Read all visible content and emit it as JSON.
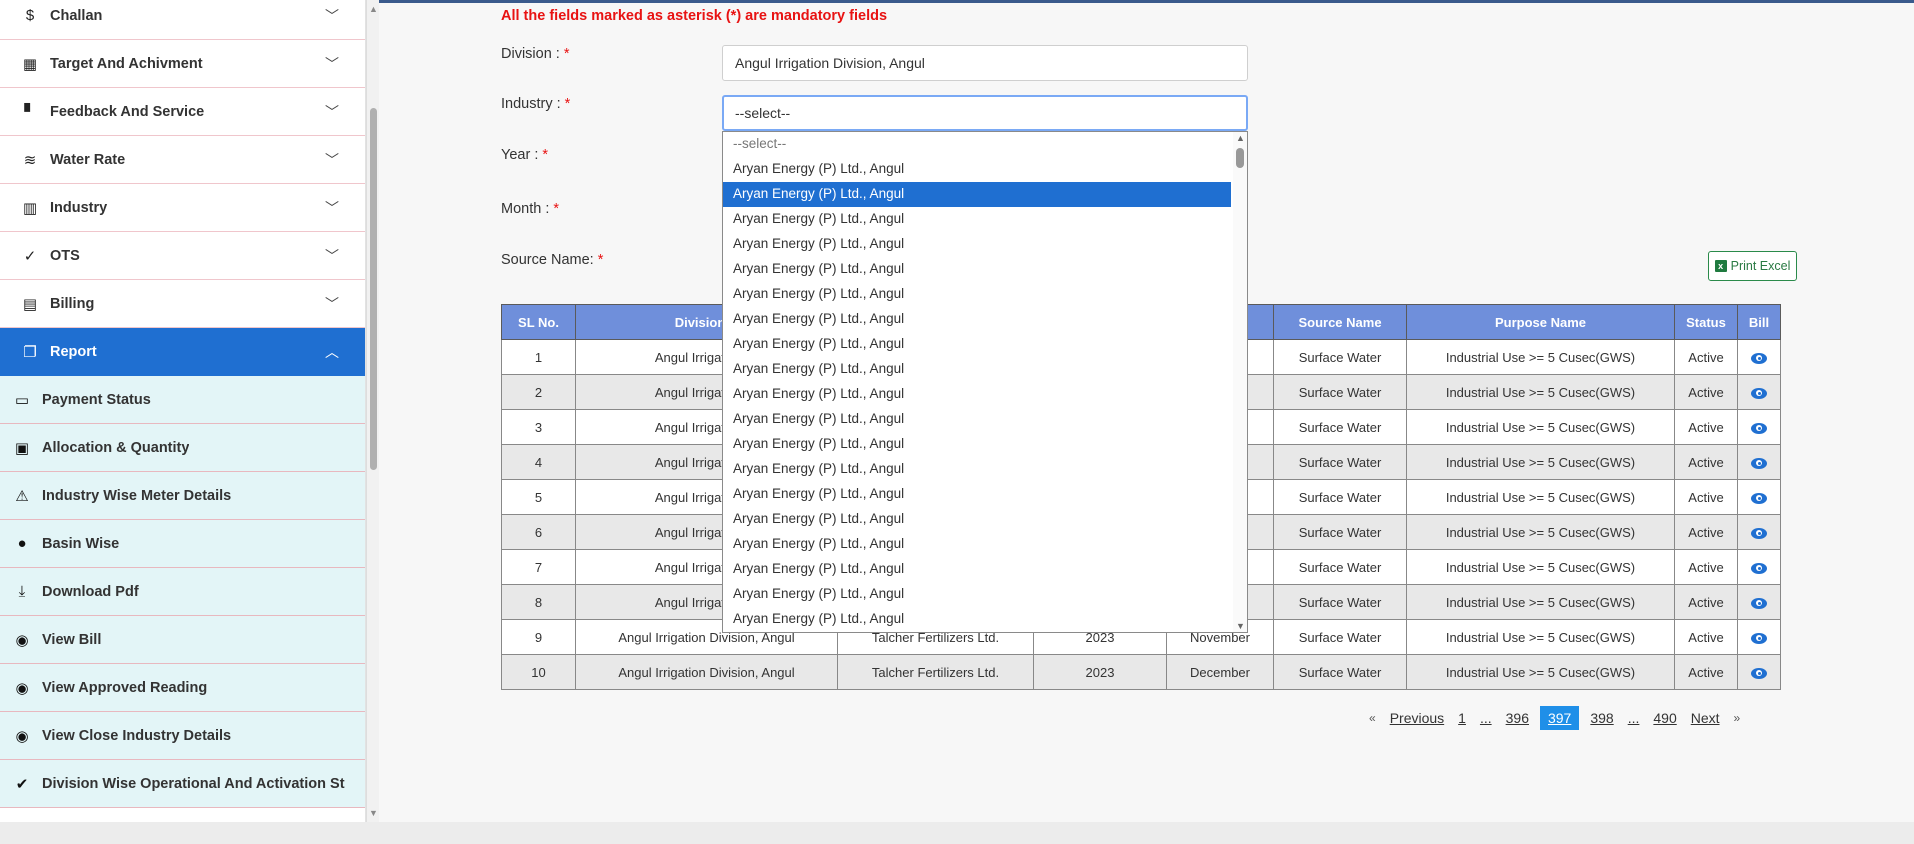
{
  "sidebar": {
    "menu": [
      {
        "label": "Challan",
        "icon": "dollar-circle-icon"
      },
      {
        "label": "Target And Achivment",
        "icon": "calendar-icon"
      },
      {
        "label": "Feedback And Service",
        "icon": "feedback-icon"
      },
      {
        "label": "Water Rate",
        "icon": "waves-icon"
      },
      {
        "label": "Industry",
        "icon": "factory-icon"
      },
      {
        "label": "OTS",
        "icon": "check-icon"
      },
      {
        "label": "Billing",
        "icon": "receipt-icon"
      },
      {
        "label": "Report",
        "icon": "library-books-icon",
        "active": true
      }
    ],
    "sub_items": [
      {
        "label": "Payment Status",
        "icon": "credit-card-icon"
      },
      {
        "label": "Allocation & Quantity",
        "icon": "clipboard-icon"
      },
      {
        "label": "Industry Wise Meter Details",
        "icon": "warning-icon"
      },
      {
        "label": "Basin Wise",
        "icon": "lightbulb-icon"
      },
      {
        "label": "Download Pdf",
        "icon": "download-icon"
      },
      {
        "label": "View Bill",
        "icon": "eye-icon"
      },
      {
        "label": "View Approved Reading",
        "icon": "eye-icon"
      },
      {
        "label": "View Close Industry Details",
        "icon": "eye-icon"
      },
      {
        "label": "Division Wise Operational And Activation St",
        "icon": "check-circle-icon"
      }
    ]
  },
  "form": {
    "mandatory_note": "All the fields marked as asterisk (*) are mandatory fields",
    "division_label": "Division :",
    "division_value": "Angul Irrigation Division, Angul",
    "industry_label": "Industry :",
    "industry_value": "--select--",
    "year_label": "Year :",
    "month_label": "Month :",
    "source_label": "Source Name:",
    "required_mark": "*",
    "print_excel": "Print Excel"
  },
  "dropdown": {
    "options": [
      "--select--",
      "Aryan Energy (P) Ltd., Angul",
      "Aryan Energy (P) Ltd., Angul",
      "Aryan Energy (P) Ltd., Angul",
      "Aryan Energy (P) Ltd., Angul",
      "Aryan Energy (P) Ltd., Angul",
      "Aryan Energy (P) Ltd., Angul",
      "Aryan Energy (P) Ltd., Angul",
      "Aryan Energy (P) Ltd., Angul",
      "Aryan Energy (P) Ltd., Angul",
      "Aryan Energy (P) Ltd., Angul",
      "Aryan Energy (P) Ltd., Angul",
      "Aryan Energy (P) Ltd., Angul",
      "Aryan Energy (P) Ltd., Angul",
      "Aryan Energy (P) Ltd., Angul",
      "Aryan Energy (P) Ltd., Angul",
      "Aryan Energy (P) Ltd., Angul",
      "Aryan Energy (P) Ltd., Angul",
      "Aryan Energy (P) Ltd., Angul",
      "Aryan Energy (P) Ltd., Angul",
      "Aryan Energy (P) Ltd., Angul"
    ],
    "highlighted_index": 2
  },
  "table": {
    "headers": [
      "SL No.",
      "Division N",
      "",
      "",
      "",
      "Source Name",
      "Purpose Name",
      "Status",
      "Bill"
    ],
    "rows": [
      [
        "1",
        "Angul Irrigation Di",
        "",
        "",
        "",
        "Surface Water",
        "Industrial Use >= 5 Cusec(GWS)",
        "Active"
      ],
      [
        "2",
        "Angul Irrigation Di",
        "",
        "",
        "",
        "Surface Water",
        "Industrial Use >= 5 Cusec(GWS)",
        "Active"
      ],
      [
        "3",
        "Angul Irrigation Di",
        "",
        "",
        "",
        "Surface Water",
        "Industrial Use >= 5 Cusec(GWS)",
        "Active"
      ],
      [
        "4",
        "Angul Irrigation Di",
        "",
        "",
        "",
        "Surface Water",
        "Industrial Use >= 5 Cusec(GWS)",
        "Active"
      ],
      [
        "5",
        "Angul Irrigation Di",
        "",
        "",
        "",
        "Surface Water",
        "Industrial Use >= 5 Cusec(GWS)",
        "Active"
      ],
      [
        "6",
        "Angul Irrigation Di",
        "",
        "",
        "",
        "Surface Water",
        "Industrial Use >= 5 Cusec(GWS)",
        "Active"
      ],
      [
        "7",
        "Angul Irrigation Di",
        "",
        "",
        "r",
        "Surface Water",
        "Industrial Use >= 5 Cusec(GWS)",
        "Active"
      ],
      [
        "8",
        "Angul Irrigation Di",
        "",
        "",
        "",
        "Surface Water",
        "Industrial Use >= 5 Cusec(GWS)",
        "Active"
      ],
      [
        "9",
        "Angul Irrigation Division, Angul",
        "Talcher Fertilizers Ltd.",
        "2023",
        "November",
        "Surface Water",
        "Industrial Use >= 5 Cusec(GWS)",
        "Active"
      ],
      [
        "10",
        "Angul Irrigation Division, Angul",
        "Talcher Fertilizers Ltd.",
        "2023",
        "December",
        "Surface Water",
        "Industrial Use >= 5 Cusec(GWS)",
        "Active"
      ]
    ]
  },
  "pagination": {
    "prev_arrow": "«",
    "previous": "Previous",
    "pages": [
      "1",
      "...",
      "396",
      "397",
      "398",
      "...",
      "490"
    ],
    "current": "397",
    "next": "Next",
    "next_arrow": "»"
  },
  "colors": {
    "accent": "#1f6fd1",
    "table_header": "#6f8fdb",
    "required": "#e81212",
    "submenu_bg": "#e3f5f7"
  }
}
